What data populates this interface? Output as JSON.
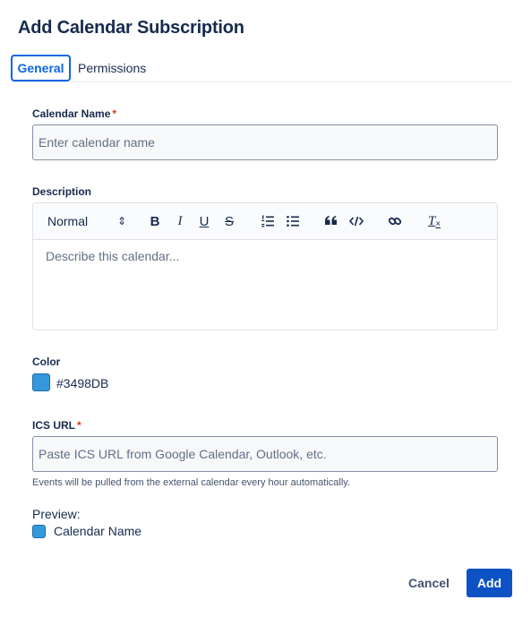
{
  "dialog": {
    "title": "Add Calendar Subscription"
  },
  "tabs": [
    {
      "label": "General",
      "active": true
    },
    {
      "label": "Permissions",
      "active": false
    }
  ],
  "fields": {
    "calendar_name": {
      "label": "Calendar Name",
      "required_mark": "*",
      "value": "",
      "placeholder": "Enter calendar name"
    },
    "description": {
      "label": "Description",
      "placeholder": "Describe this calendar...",
      "toolbar": {
        "format_value": "Normal",
        "format_arrow": "⇕",
        "bold": "B",
        "italic": "I",
        "underline": "U",
        "strike": "S",
        "clear": "T",
        "icons": [
          "ordered-list-icon",
          "bullet-list-icon",
          "quote-icon",
          "code-icon",
          "link-icon",
          "clear-format-icon"
        ]
      }
    },
    "color": {
      "label": "Color",
      "value": "#3498DB"
    },
    "ics_url": {
      "label": "ICS URL",
      "required_mark": "*",
      "value": "",
      "placeholder": "Paste ICS URL from Google Calendar, Outlook, etc.",
      "helper": "Events will be pulled from the external calendar every hour automatically."
    }
  },
  "preview": {
    "label": "Preview:",
    "name": "Calendar Name",
    "color": "#3498DB"
  },
  "actions": {
    "cancel_label": "Cancel",
    "submit_label": "Add"
  },
  "colors": {
    "accent": "#0c66e4",
    "primary_button": "#0c52c4",
    "required": "#de350b"
  }
}
